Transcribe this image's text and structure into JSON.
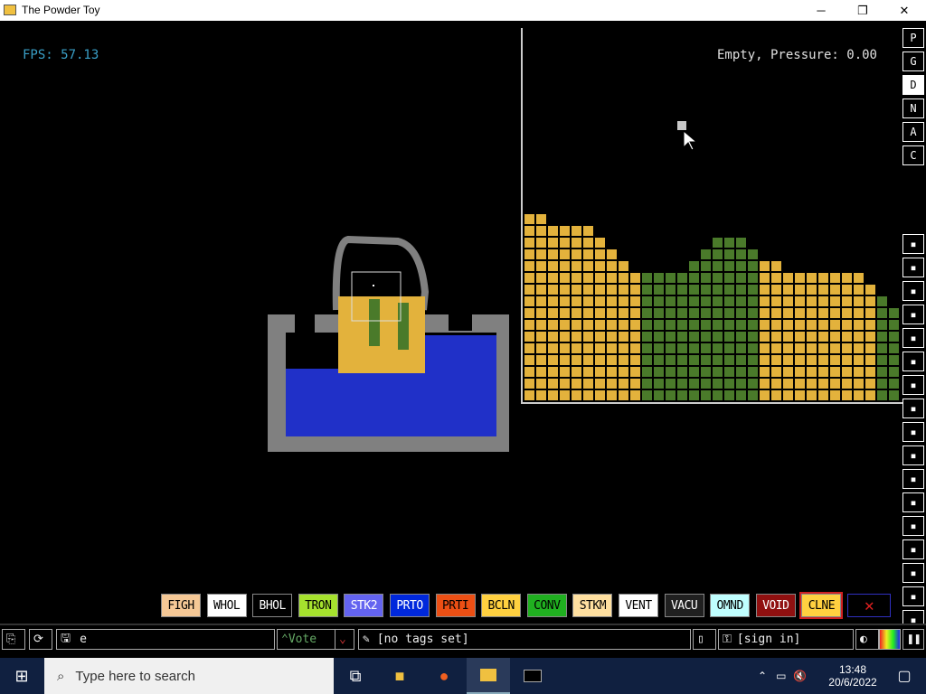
{
  "window": {
    "title": "The Powder Toy",
    "minimize": "─",
    "maximize": "❐",
    "close": "✕"
  },
  "hud": {
    "fps": "FPS: 57.13",
    "status": "Empty, Pressure: 0.00"
  },
  "menu_categories": [
    {
      "label": "P",
      "icon": "powders"
    },
    {
      "label": "G",
      "icon": "gases"
    },
    {
      "label": "D",
      "icon": "decoration",
      "selected": true
    },
    {
      "label": "N",
      "icon": "nuclear"
    },
    {
      "label": "A",
      "icon": "alternate"
    },
    {
      "label": "C",
      "icon": "custom"
    }
  ],
  "tool_icons": [
    "keyboard-icon",
    "plug-icon",
    "power-icon",
    "gauge-icon",
    "arrows-icon",
    "spray-icon",
    "pencil-icon",
    "drop-icon",
    "flask-icon",
    "square-icon",
    "radiation-icon",
    "star-icon",
    "dots-icon",
    "bulb-icon",
    "bookmark-icon",
    "hammer-icon",
    "magnify-icon"
  ],
  "elements": [
    {
      "label": "FIGH",
      "bg": "#f5c896",
      "fg": "#000000"
    },
    {
      "label": "WHOL",
      "bg": "#ffffff",
      "fg": "#000000"
    },
    {
      "label": "BHOL",
      "bg": "#000000",
      "fg": "#ffffff"
    },
    {
      "label": "TRON",
      "bg": "#a6e22e",
      "fg": "#000000"
    },
    {
      "label": "STK2",
      "bg": "#6464f0",
      "fg": "#ffffff"
    },
    {
      "label": "PRTO",
      "bg": "#0028dc",
      "fg": "#ffffff"
    },
    {
      "label": "PRTI",
      "bg": "#ec4f14",
      "fg": "#000000"
    },
    {
      "label": "BCLN",
      "bg": "#ffd040",
      "fg": "#000000"
    },
    {
      "label": "CONV",
      "bg": "#20b020",
      "fg": "#000000"
    },
    {
      "label": "STKM",
      "bg": "#ffe0a0",
      "fg": "#000000"
    },
    {
      "label": "VENT",
      "bg": "#ffffff",
      "fg": "#000000"
    },
    {
      "label": "VACU",
      "bg": "#202020",
      "fg": "#ffffff"
    },
    {
      "label": "OMND",
      "bg": "#c0ffff",
      "fg": "#000000"
    },
    {
      "label": "VOID",
      "bg": "#901010",
      "fg": "#ffffff"
    },
    {
      "label": "CLNE",
      "bg": "#ffd040",
      "fg": "#000000",
      "selected": true
    },
    {
      "label": "✕",
      "bg": "#000000",
      "fg": "#e02020"
    }
  ],
  "bottom": {
    "search": "e",
    "vote": "Vote",
    "tags": "[no tags set]",
    "signin": "[sign in]"
  },
  "taskbar": {
    "search_placeholder": "Type here to search",
    "time": "13:48",
    "date": "20/6/2022"
  },
  "colors": {
    "sand": "#e3b23c",
    "plant": "#4a7a2a",
    "water": "#2030c8",
    "wall": "#808080"
  }
}
